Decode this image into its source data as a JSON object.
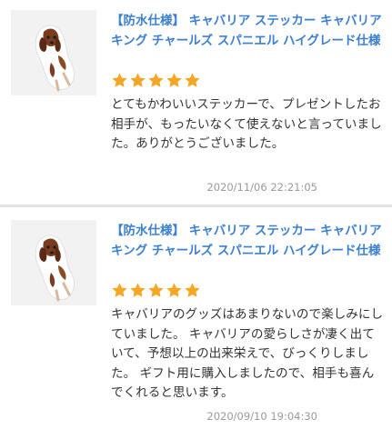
{
  "reviews": [
    {
      "product_title": "【防水仕様】 キャバリア ステッカー キャバリア キング チャールズ スパニエル ハイグレード仕様",
      "rating": 5,
      "body": "とてもかわいいステッカーで、プレゼントしたお相手が、もったいなくて使えないと言っていました。ありがとうございました。",
      "date": "2020/11/06 22:21:05"
    },
    {
      "product_title": "【防水仕様】 キャバリア ステッカー キャバリア キング チャールズ スパニエル ハイグレード仕様",
      "rating": 5,
      "body": "キャバリアのグッズはあまりないので楽しみにしていました。 キャバリアの愛らしさが凄く出ていて、予想以上の出来栄えで、びっくりしました。 ギフト用に購入しましたので、相手も喜んでくれると思います。",
      "date": "2020/09/10 19:04:30"
    }
  ],
  "colors": {
    "title": "#3b7fd1",
    "star": "#f5a623",
    "date": "#9a9a9a"
  },
  "icons": {
    "product": "cavalier-dog-sticker-thumbnail",
    "rating": "star-icon"
  }
}
